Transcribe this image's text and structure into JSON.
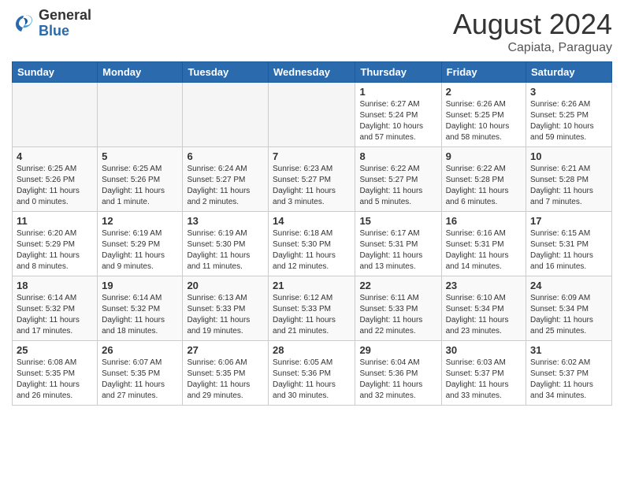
{
  "header": {
    "logo": {
      "general": "General",
      "blue": "Blue"
    },
    "title": "August 2024",
    "location": "Capiata, Paraguay"
  },
  "calendar": {
    "days_of_week": [
      "Sunday",
      "Monday",
      "Tuesday",
      "Wednesday",
      "Thursday",
      "Friday",
      "Saturday"
    ],
    "weeks": [
      [
        {
          "day": "",
          "info": ""
        },
        {
          "day": "",
          "info": ""
        },
        {
          "day": "",
          "info": ""
        },
        {
          "day": "",
          "info": ""
        },
        {
          "day": "1",
          "info": "Sunrise: 6:27 AM\nSunset: 5:24 PM\nDaylight: 10 hours\nand 57 minutes."
        },
        {
          "day": "2",
          "info": "Sunrise: 6:26 AM\nSunset: 5:25 PM\nDaylight: 10 hours\nand 58 minutes."
        },
        {
          "day": "3",
          "info": "Sunrise: 6:26 AM\nSunset: 5:25 PM\nDaylight: 10 hours\nand 59 minutes."
        }
      ],
      [
        {
          "day": "4",
          "info": "Sunrise: 6:25 AM\nSunset: 5:26 PM\nDaylight: 11 hours\nand 0 minutes."
        },
        {
          "day": "5",
          "info": "Sunrise: 6:25 AM\nSunset: 5:26 PM\nDaylight: 11 hours\nand 1 minute."
        },
        {
          "day": "6",
          "info": "Sunrise: 6:24 AM\nSunset: 5:27 PM\nDaylight: 11 hours\nand 2 minutes."
        },
        {
          "day": "7",
          "info": "Sunrise: 6:23 AM\nSunset: 5:27 PM\nDaylight: 11 hours\nand 3 minutes."
        },
        {
          "day": "8",
          "info": "Sunrise: 6:22 AM\nSunset: 5:27 PM\nDaylight: 11 hours\nand 5 minutes."
        },
        {
          "day": "9",
          "info": "Sunrise: 6:22 AM\nSunset: 5:28 PM\nDaylight: 11 hours\nand 6 minutes."
        },
        {
          "day": "10",
          "info": "Sunrise: 6:21 AM\nSunset: 5:28 PM\nDaylight: 11 hours\nand 7 minutes."
        }
      ],
      [
        {
          "day": "11",
          "info": "Sunrise: 6:20 AM\nSunset: 5:29 PM\nDaylight: 11 hours\nand 8 minutes."
        },
        {
          "day": "12",
          "info": "Sunrise: 6:19 AM\nSunset: 5:29 PM\nDaylight: 11 hours\nand 9 minutes."
        },
        {
          "day": "13",
          "info": "Sunrise: 6:19 AM\nSunset: 5:30 PM\nDaylight: 11 hours\nand 11 minutes."
        },
        {
          "day": "14",
          "info": "Sunrise: 6:18 AM\nSunset: 5:30 PM\nDaylight: 11 hours\nand 12 minutes."
        },
        {
          "day": "15",
          "info": "Sunrise: 6:17 AM\nSunset: 5:31 PM\nDaylight: 11 hours\nand 13 minutes."
        },
        {
          "day": "16",
          "info": "Sunrise: 6:16 AM\nSunset: 5:31 PM\nDaylight: 11 hours\nand 14 minutes."
        },
        {
          "day": "17",
          "info": "Sunrise: 6:15 AM\nSunset: 5:31 PM\nDaylight: 11 hours\nand 16 minutes."
        }
      ],
      [
        {
          "day": "18",
          "info": "Sunrise: 6:14 AM\nSunset: 5:32 PM\nDaylight: 11 hours\nand 17 minutes."
        },
        {
          "day": "19",
          "info": "Sunrise: 6:14 AM\nSunset: 5:32 PM\nDaylight: 11 hours\nand 18 minutes."
        },
        {
          "day": "20",
          "info": "Sunrise: 6:13 AM\nSunset: 5:33 PM\nDaylight: 11 hours\nand 19 minutes."
        },
        {
          "day": "21",
          "info": "Sunrise: 6:12 AM\nSunset: 5:33 PM\nDaylight: 11 hours\nand 21 minutes."
        },
        {
          "day": "22",
          "info": "Sunrise: 6:11 AM\nSunset: 5:33 PM\nDaylight: 11 hours\nand 22 minutes."
        },
        {
          "day": "23",
          "info": "Sunrise: 6:10 AM\nSunset: 5:34 PM\nDaylight: 11 hours\nand 23 minutes."
        },
        {
          "day": "24",
          "info": "Sunrise: 6:09 AM\nSunset: 5:34 PM\nDaylight: 11 hours\nand 25 minutes."
        }
      ],
      [
        {
          "day": "25",
          "info": "Sunrise: 6:08 AM\nSunset: 5:35 PM\nDaylight: 11 hours\nand 26 minutes."
        },
        {
          "day": "26",
          "info": "Sunrise: 6:07 AM\nSunset: 5:35 PM\nDaylight: 11 hours\nand 27 minutes."
        },
        {
          "day": "27",
          "info": "Sunrise: 6:06 AM\nSunset: 5:35 PM\nDaylight: 11 hours\nand 29 minutes."
        },
        {
          "day": "28",
          "info": "Sunrise: 6:05 AM\nSunset: 5:36 PM\nDaylight: 11 hours\nand 30 minutes."
        },
        {
          "day": "29",
          "info": "Sunrise: 6:04 AM\nSunset: 5:36 PM\nDaylight: 11 hours\nand 32 minutes."
        },
        {
          "day": "30",
          "info": "Sunrise: 6:03 AM\nSunset: 5:37 PM\nDaylight: 11 hours\nand 33 minutes."
        },
        {
          "day": "31",
          "info": "Sunrise: 6:02 AM\nSunset: 5:37 PM\nDaylight: 11 hours\nand 34 minutes."
        }
      ]
    ]
  }
}
